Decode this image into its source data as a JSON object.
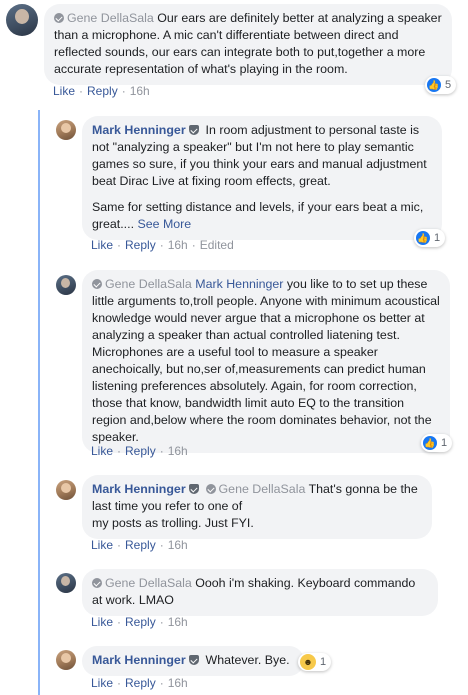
{
  "colors": {
    "accent": "#385898",
    "bubble": "#f2f3f5",
    "like_blue": "#1877f2",
    "thread_line": "#8ab4f8"
  },
  "comments": [
    {
      "author": "Gene DellaSala",
      "text": "Our ears are definitely better at analyzing a speaker than a microphone. A mic can't differentiate between direct and reflected sounds, our ears can integrate both to put,together a more accurate representation of what's playing in the room.",
      "reaction_count": "5",
      "reaction_icon": "like-icon",
      "actions": {
        "like": "Like",
        "reply": "Reply",
        "time": "16h"
      }
    },
    {
      "author": "Mark Henninger",
      "text_1": "In room adjustment to personal taste is not \"analyzing a speaker\" but I'm not here to play semantic games so sure, if you think your ears and manual adjustment beat Dirac Live at fixing room effects, great.",
      "text_2": "Same for setting distance and levels, if your ears beat a mic, great....",
      "see_more": "See More",
      "reaction_count": "1",
      "reaction_icon": "like-icon",
      "actions": {
        "like": "Like",
        "reply": "Reply",
        "time": "16h",
        "edited": "Edited"
      }
    },
    {
      "author": "Gene DellaSala",
      "mention": "Mark Henninger",
      "text": "you like to to set up these little arguments to,troll people. Anyone with minimum acoustical knowledge would never argue that a microphone os better at analyzing a speaker than actual controlled liatening test. Microphones are a useful tool to measure a speaker anechoically, but no,ser of,measurements can predict human listening preferences absolutely. Again, for room correction, those that know, bandwidth limit auto EQ to the transition region and,below where the room dominates behavior, not the speaker.",
      "reaction_count": "1",
      "reaction_icon": "like-icon",
      "actions": {
        "like": "Like",
        "reply": "Reply",
        "time": "16h"
      }
    },
    {
      "author": "Mark Henninger",
      "mention": "Gene DellaSala",
      "text_1": "That's gonna be the last time you refer to one of",
      "text_2": "my posts as trolling. Just FYI.",
      "actions": {
        "like": "Like",
        "reply": "Reply",
        "time": "16h"
      }
    },
    {
      "author": "Gene DellaSala",
      "text": "Oooh i'm shaking. Keyboard commando at work. LMAO",
      "actions": {
        "like": "Like",
        "reply": "Reply",
        "time": "16h"
      }
    },
    {
      "author": "Mark Henninger",
      "text": "Whatever. Bye.",
      "reaction_count": "1",
      "reaction_icon": "haha-icon",
      "actions": {
        "like": "Like",
        "reply": "Reply",
        "time": "16h"
      }
    }
  ]
}
